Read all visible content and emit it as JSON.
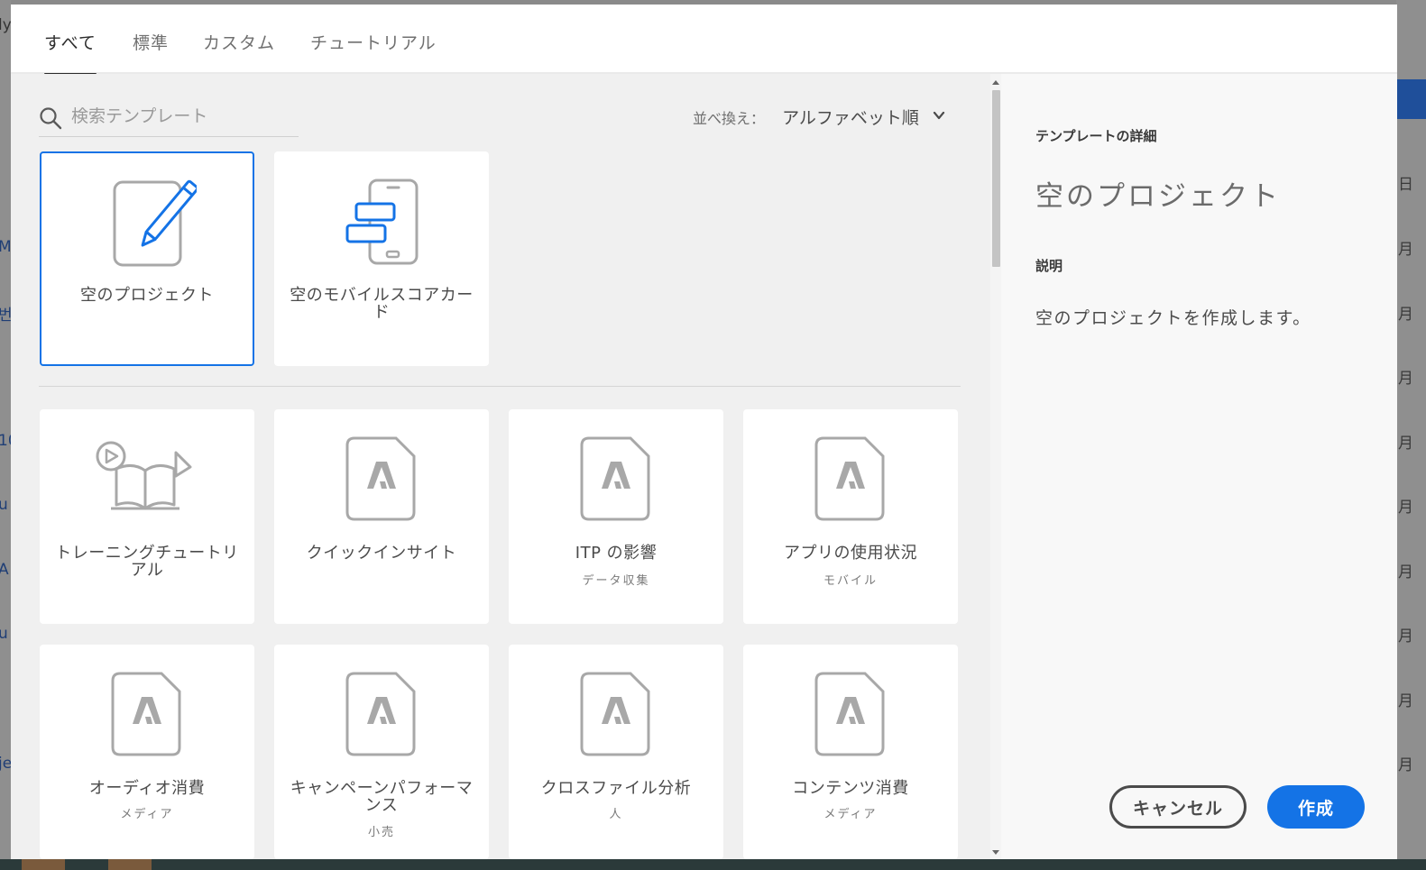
{
  "tabs": [
    {
      "label": "すべて",
      "active": true
    },
    {
      "label": "標準",
      "active": false
    },
    {
      "label": "カスタム",
      "active": false
    },
    {
      "label": "チュートリアル",
      "active": false
    }
  ],
  "search": {
    "placeholder": "検索テンプレート"
  },
  "sort": {
    "label": "並べ換え：",
    "value": "アルファベット順"
  },
  "blank_templates": [
    {
      "title": "空のプロジェクト",
      "icon": "pencil-document-icon",
      "selected": true
    },
    {
      "title": "空のモバイルスコアカード",
      "icon": "mobile-scorecard-icon",
      "selected": false
    }
  ],
  "templates": [
    {
      "title": "トレーニングチュートリアル",
      "subtitle": "",
      "icon": "tutorial-book-icon"
    },
    {
      "title": "クイックインサイト",
      "subtitle": "",
      "icon": "adobe-document-icon"
    },
    {
      "title": "ITP の影響",
      "subtitle": "データ収集",
      "icon": "adobe-document-icon"
    },
    {
      "title": "アプリの使用状況",
      "subtitle": "モバイル",
      "icon": "adobe-document-icon"
    },
    {
      "title": "オーディオ消費",
      "subtitle": "メディア",
      "icon": "adobe-document-icon"
    },
    {
      "title": "キャンペーンパフォーマンス",
      "subtitle": "小売",
      "icon": "adobe-document-icon"
    },
    {
      "title": "クロスファイル分析",
      "subtitle": "人",
      "icon": "adobe-document-icon"
    },
    {
      "title": "コンテンツ消費",
      "subtitle": "メディア",
      "icon": "adobe-document-icon"
    }
  ],
  "details": {
    "heading": "テンプレートの詳細",
    "title": "空のプロジェクト",
    "description_heading": "説明",
    "description": "空のプロジェクトを作成します。"
  },
  "buttons": {
    "cancel": "キャンセル",
    "create": "作成"
  },
  "colors": {
    "accent": "#1473e6",
    "panel": "#f0f0f0",
    "icon_gray": "#a8a8a8"
  }
}
